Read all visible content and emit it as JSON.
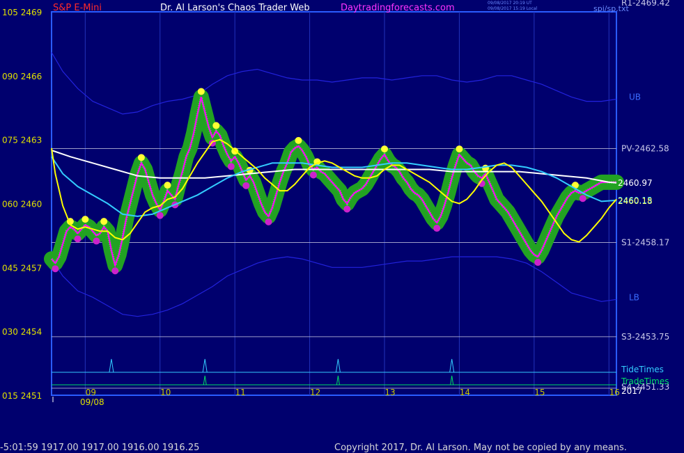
{
  "header": {
    "symbol": "S&P E-Mini",
    "title": "Dr. Al Larson's Chaos Trader Web",
    "site": "Daytradingforecasts.com",
    "stamp_line1": "09/08/2017 20:19 UT",
    "stamp_line2": "09/08/2017 15:19 Local",
    "corner_label": "spi/sp.txt"
  },
  "footer": {
    "quote_line": "-5:01:59  1917.00 1917.00 1916.00 1916.25",
    "copyright": "Copyright 2017, Dr. Al Larson. May not be copied by any means."
  },
  "colors": {
    "background": "#00006e",
    "frame": "#2a5cff",
    "price": "#ff00ff",
    "fast_ma": "#ffff00",
    "mid_ma": "#33ccff",
    "slow_ma": "#ffffff",
    "bands": "#2222dd",
    "halo": "#22a222",
    "level": "#b8b8d8",
    "tide": "#33ccff",
    "trade": "#00dd66"
  },
  "chart_data": {
    "type": "line",
    "title": "S&P E-Mini",
    "ylim": [
      2451,
      2469
    ],
    "y_ticks": [
      {
        "value": 2469,
        "label": "105  2469"
      },
      {
        "value": 2466,
        "label": "090  2466"
      },
      {
        "value": 2463,
        "label": "075  2463"
      },
      {
        "value": 2460,
        "label": "060  2460"
      },
      {
        "value": 2457,
        "label": "045  2457"
      },
      {
        "value": 2454,
        "label": "030  2454"
      },
      {
        "value": 2451,
        "label": "015  2451"
      }
    ],
    "xlim": [
      8.55,
      16.1
    ],
    "x_ticks": [
      {
        "hour": 9,
        "label": "09"
      },
      {
        "hour": 10,
        "label": "10"
      },
      {
        "hour": 11,
        "label": "11"
      },
      {
        "hour": 12,
        "label": "12"
      },
      {
        "hour": 13,
        "label": "13"
      },
      {
        "hour": 14,
        "label": "14"
      },
      {
        "hour": 15,
        "label": "15"
      },
      {
        "hour": 16,
        "label": "16"
      }
    ],
    "date_label": "09/08",
    "year_label": "2017",
    "levels": [
      {
        "name": "R1",
        "value": 2469.42,
        "label": "R1-2469.42"
      },
      {
        "name": "PV",
        "value": 2462.58,
        "label": "PV-2462.58"
      },
      {
        "name": "S1",
        "value": 2458.17,
        "label": "S1-2458.17"
      },
      {
        "name": "S3",
        "value": 2453.75,
        "label": "S3-2453.75"
      },
      {
        "name": "S4",
        "value": 2451.33,
        "label": "S4-2451.33"
      }
    ],
    "band_labels": {
      "upper": "UB",
      "lower": "LB"
    },
    "last_values": [
      {
        "series": "slow",
        "value": 2460.97,
        "label": "2460.97"
      },
      {
        "series": "mid",
        "value": 2460.15,
        "label": "2460.15"
      },
      {
        "series": "fast",
        "value": 2460.18,
        "label": "2460.18"
      }
    ],
    "timing_rows": {
      "tide_label": "TideTimes",
      "trade_label": "TradeTimes"
    },
    "tide_times": [
      9.35,
      10.6,
      12.38,
      13.9
    ],
    "trade_times": [
      10.6,
      12.38,
      13.9
    ],
    "series": [
      {
        "key": "price",
        "x": [
          8.55,
          8.6,
          8.65,
          8.7,
          8.75,
          8.8,
          8.85,
          8.9,
          8.95,
          9.0,
          9.05,
          9.1,
          9.15,
          9.2,
          9.25,
          9.3,
          9.35,
          9.4,
          9.45,
          9.5,
          9.55,
          9.6,
          9.65,
          9.7,
          9.75,
          9.8,
          9.85,
          9.9,
          9.95,
          10.0,
          10.05,
          10.1,
          10.15,
          10.2,
          10.25,
          10.3,
          10.35,
          10.4,
          10.45,
          10.5,
          10.55,
          10.6,
          10.65,
          10.7,
          10.75,
          10.8,
          10.85,
          10.9,
          10.95,
          11.0,
          11.05,
          11.1,
          11.15,
          11.2,
          11.25,
          11.3,
          11.35,
          11.4,
          11.45,
          11.5,
          11.55,
          11.6,
          11.65,
          11.7,
          11.75,
          11.8,
          11.85,
          11.9,
          11.95,
          12.0,
          12.05,
          12.1,
          12.15,
          12.2,
          12.25,
          12.3,
          12.35,
          12.4,
          12.45,
          12.5,
          12.55,
          12.6,
          12.65,
          12.7,
          12.75,
          12.8,
          12.85,
          12.9,
          12.95,
          13.0,
          13.05,
          13.1,
          13.15,
          13.2,
          13.25,
          13.3,
          13.35,
          13.4,
          13.45,
          13.5,
          13.55,
          13.6,
          13.65,
          13.7,
          13.75,
          13.8,
          13.85,
          13.9,
          13.95,
          14.0,
          14.05,
          14.1,
          14.15,
          14.2,
          14.25,
          14.3,
          14.35,
          14.4,
          14.45,
          14.5,
          14.55,
          14.6,
          14.65,
          14.7,
          14.75,
          14.8,
          14.85,
          14.9,
          14.95,
          15.0,
          15.05,
          15.1,
          15.15,
          15.2,
          15.25,
          15.3,
          15.35,
          15.4,
          15.45,
          15.5,
          15.55,
          15.6,
          15.65,
          15.7,
          15.75,
          15.8,
          15.85,
          15.9,
          15.95,
          16.0,
          16.05,
          16.1
        ],
        "y": [
          2457.4,
          2457.2,
          2457.5,
          2458.1,
          2458.7,
          2458.9,
          2458.8,
          2458.6,
          2458.8,
          2459.0,
          2458.9,
          2458.7,
          2458.5,
          2458.6,
          2458.9,
          2458.7,
          2457.8,
          2457.1,
          2457.6,
          2458.4,
          2459.3,
          2460.0,
          2460.7,
          2461.4,
          2461.9,
          2461.6,
          2461.0,
          2460.4,
          2460.0,
          2459.7,
          2460.1,
          2460.6,
          2460.4,
          2460.2,
          2460.9,
          2461.5,
          2462.2,
          2462.6,
          2463.3,
          2464.2,
          2465.0,
          2464.3,
          2463.6,
          2463.1,
          2463.4,
          2463.2,
          2462.7,
          2462.3,
          2462.0,
          2462.2,
          2461.9,
          2461.5,
          2461.1,
          2461.3,
          2461.0,
          2460.5,
          2460.0,
          2459.6,
          2459.4,
          2459.8,
          2460.4,
          2461.0,
          2461.5,
          2461.9,
          2462.4,
          2462.6,
          2462.7,
          2462.5,
          2462.2,
          2461.8,
          2461.6,
          2461.7,
          2461.5,
          2461.4,
          2461.2,
          2461.0,
          2460.8,
          2460.6,
          2460.2,
          2460.0,
          2460.3,
          2460.5,
          2460.6,
          2460.7,
          2460.9,
          2461.2,
          2461.5,
          2461.8,
          2462.1,
          2462.3,
          2462.0,
          2461.8,
          2461.7,
          2461.5,
          2461.2,
          2461.0,
          2460.7,
          2460.5,
          2460.4,
          2460.2,
          2459.9,
          2459.6,
          2459.3,
          2459.1,
          2459.4,
          2459.9,
          2460.5,
          2461.2,
          2461.8,
          2462.3,
          2462.1,
          2461.9,
          2461.8,
          2461.5,
          2461.3,
          2461.2,
          2461.4,
          2461.0,
          2460.6,
          2460.2,
          2460.0,
          2459.8,
          2459.6,
          2459.3,
          2459.0,
          2458.7,
          2458.4,
          2458.1,
          2457.8,
          2457.6,
          2457.5,
          2457.8,
          2458.2,
          2458.6,
          2459.0,
          2459.4,
          2459.7,
          2460.0,
          2460.3,
          2460.5,
          2460.6,
          2460.5,
          2460.5,
          2460.6,
          2460.7,
          2460.8,
          2460.9,
          2461.0,
          2461.0,
          2461.0,
          2461.0,
          2461.0
        ]
      },
      {
        "key": "fast",
        "x": [
          8.55,
          8.6,
          8.7,
          8.8,
          8.9,
          9.0,
          9.1,
          9.2,
          9.3,
          9.4,
          9.5,
          9.6,
          9.7,
          9.8,
          9.9,
          10.0,
          10.1,
          10.2,
          10.3,
          10.4,
          10.5,
          10.6,
          10.7,
          10.8,
          10.9,
          11.0,
          11.1,
          11.2,
          11.3,
          11.4,
          11.5,
          11.6,
          11.7,
          11.8,
          11.9,
          12.0,
          12.1,
          12.2,
          12.3,
          12.4,
          12.5,
          12.6,
          12.7,
          12.8,
          12.9,
          13.0,
          13.1,
          13.2,
          13.3,
          13.4,
          13.5,
          13.6,
          13.7,
          13.8,
          13.9,
          14.0,
          14.1,
          14.2,
          14.3,
          14.4,
          14.5,
          14.6,
          14.7,
          14.8,
          14.9,
          15.0,
          15.1,
          15.2,
          15.3,
          15.4,
          15.5,
          15.6,
          15.7,
          15.8,
          15.9,
          16.0,
          16.1
        ],
        "y": [
          2462.6,
          2461.4,
          2459.9,
          2459.0,
          2458.8,
          2458.9,
          2458.8,
          2458.7,
          2458.7,
          2458.4,
          2458.3,
          2458.6,
          2459.1,
          2459.6,
          2459.8,
          2459.9,
          2460.2,
          2460.3,
          2460.7,
          2461.3,
          2461.9,
          2462.4,
          2462.9,
          2463.0,
          2462.8,
          2462.5,
          2462.2,
          2461.9,
          2461.6,
          2461.2,
          2460.9,
          2460.6,
          2460.6,
          2460.9,
          2461.3,
          2461.7,
          2461.9,
          2462.0,
          2461.9,
          2461.7,
          2461.5,
          2461.3,
          2461.2,
          2461.2,
          2461.3,
          2461.6,
          2461.8,
          2461.8,
          2461.6,
          2461.4,
          2461.2,
          2461.0,
          2460.7,
          2460.4,
          2460.1,
          2460.0,
          2460.2,
          2460.6,
          2461.1,
          2461.5,
          2461.8,
          2461.9,
          2461.7,
          2461.3,
          2460.9,
          2460.5,
          2460.1,
          2459.6,
          2459.1,
          2458.6,
          2458.3,
          2458.2,
          2458.5,
          2458.9,
          2459.3,
          2459.8,
          2460.2
        ]
      },
      {
        "key": "mid",
        "x": [
          8.55,
          8.7,
          8.9,
          9.1,
          9.3,
          9.5,
          9.7,
          9.9,
          10.1,
          10.3,
          10.5,
          10.7,
          10.9,
          11.1,
          11.3,
          11.5,
          11.7,
          11.9,
          12.1,
          12.3,
          12.5,
          12.7,
          12.9,
          13.1,
          13.3,
          13.5,
          13.7,
          13.9,
          14.1,
          14.3,
          14.5,
          14.7,
          14.9,
          15.1,
          15.3,
          15.5,
          15.7,
          15.9,
          16.1
        ],
        "y": [
          2462.2,
          2461.4,
          2460.8,
          2460.4,
          2460.0,
          2459.5,
          2459.4,
          2459.5,
          2459.8,
          2460.1,
          2460.4,
          2460.8,
          2461.2,
          2461.5,
          2461.7,
          2461.9,
          2461.9,
          2461.9,
          2461.8,
          2461.7,
          2461.7,
          2461.7,
          2461.8,
          2461.9,
          2461.9,
          2461.8,
          2461.7,
          2461.6,
          2461.6,
          2461.7,
          2461.8,
          2461.8,
          2461.7,
          2461.5,
          2461.2,
          2460.8,
          2460.4,
          2460.1,
          2460.15
        ]
      },
      {
        "key": "slow",
        "x": [
          8.55,
          8.8,
          9.1,
          9.4,
          9.7,
          10.0,
          10.3,
          10.6,
          10.9,
          11.2,
          11.5,
          11.8,
          12.1,
          12.4,
          12.7,
          13.0,
          13.3,
          13.6,
          13.9,
          14.2,
          14.5,
          14.8,
          15.1,
          15.4,
          15.7,
          16.0,
          16.1
        ],
        "y": [
          2462.5,
          2462.2,
          2461.9,
          2461.6,
          2461.3,
          2461.2,
          2461.2,
          2461.2,
          2461.3,
          2461.4,
          2461.5,
          2461.6,
          2461.6,
          2461.6,
          2461.6,
          2461.6,
          2461.6,
          2461.6,
          2461.5,
          2461.5,
          2461.5,
          2461.5,
          2461.4,
          2461.3,
          2461.2,
          2461.0,
          2460.97
        ]
      },
      {
        "key": "ub",
        "x": [
          8.55,
          8.7,
          8.9,
          9.1,
          9.3,
          9.5,
          9.7,
          9.9,
          10.1,
          10.3,
          10.5,
          10.7,
          10.9,
          11.1,
          11.3,
          11.5,
          11.7,
          11.9,
          12.1,
          12.3,
          12.5,
          12.7,
          12.9,
          13.1,
          13.3,
          13.5,
          13.7,
          13.9,
          14.1,
          14.3,
          14.5,
          14.7,
          14.9,
          15.1,
          15.3,
          15.5,
          15.7,
          15.9,
          16.1
        ],
        "y": [
          2467.1,
          2466.2,
          2465.4,
          2464.8,
          2464.5,
          2464.2,
          2464.3,
          2464.6,
          2464.8,
          2464.9,
          2465.1,
          2465.6,
          2466.0,
          2466.2,
          2466.3,
          2466.1,
          2465.9,
          2465.8,
          2465.8,
          2465.7,
          2465.8,
          2465.9,
          2465.9,
          2465.8,
          2465.9,
          2466.0,
          2466.0,
          2465.8,
          2465.7,
          2465.8,
          2466.0,
          2466.0,
          2465.8,
          2465.6,
          2465.3,
          2465.0,
          2464.8,
          2464.8,
          2464.9
        ]
      },
      {
        "key": "lb",
        "x": [
          8.55,
          8.7,
          8.9,
          9.1,
          9.3,
          9.5,
          9.7,
          9.9,
          10.1,
          10.3,
          10.5,
          10.7,
          10.9,
          11.1,
          11.3,
          11.5,
          11.7,
          11.9,
          12.1,
          12.3,
          12.5,
          12.7,
          12.9,
          13.1,
          13.3,
          13.5,
          13.7,
          13.9,
          14.1,
          14.3,
          14.5,
          14.7,
          14.9,
          15.1,
          15.3,
          15.5,
          15.7,
          15.9,
          16.1
        ],
        "y": [
          2457.4,
          2456.6,
          2455.9,
          2455.6,
          2455.2,
          2454.8,
          2454.7,
          2454.8,
          2455.0,
          2455.3,
          2455.7,
          2456.1,
          2456.6,
          2456.9,
          2457.2,
          2457.4,
          2457.5,
          2457.4,
          2457.2,
          2457.0,
          2457.0,
          2457.0,
          2457.1,
          2457.2,
          2457.3,
          2457.3,
          2457.4,
          2457.5,
          2457.5,
          2457.5,
          2457.5,
          2457.4,
          2457.2,
          2456.8,
          2456.3,
          2455.8,
          2455.6,
          2455.4,
          2455.5
        ]
      }
    ]
  }
}
